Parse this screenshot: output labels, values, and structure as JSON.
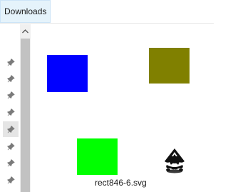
{
  "address_bar": {
    "current_folder": "Downloads"
  },
  "nav_pane": {
    "pins": [
      {
        "icon": "pin-icon",
        "selected": false
      },
      {
        "icon": "pin-icon",
        "selected": false
      },
      {
        "icon": "pin-icon",
        "selected": false
      },
      {
        "icon": "pin-icon",
        "selected": false
      },
      {
        "icon": "pin-icon",
        "selected": true
      },
      {
        "icon": "pin-icon",
        "selected": false
      },
      {
        "icon": "pin-icon",
        "selected": false
      },
      {
        "icon": "pin-icon",
        "selected": false
      }
    ],
    "scroll_up_icon": "chevron-up-icon"
  },
  "files": [
    {
      "name": "blue-rectangle-thumbnail",
      "color": "#0000ff"
    },
    {
      "name": "olive-rectangle-thumbnail",
      "color": "#808000"
    },
    {
      "name": "green-rectangle-thumbnail",
      "color": "#00ff00"
    },
    {
      "name": "inkscape-file",
      "label": "rect846-6.svg",
      "icon": "inkscape-icon"
    }
  ],
  "colors": {
    "selection_highlight": "#e5f3fb",
    "scrollbar_thumb": "#c2c2c2",
    "blue": "#0000ff",
    "olive": "#808000",
    "green": "#00ff00"
  }
}
